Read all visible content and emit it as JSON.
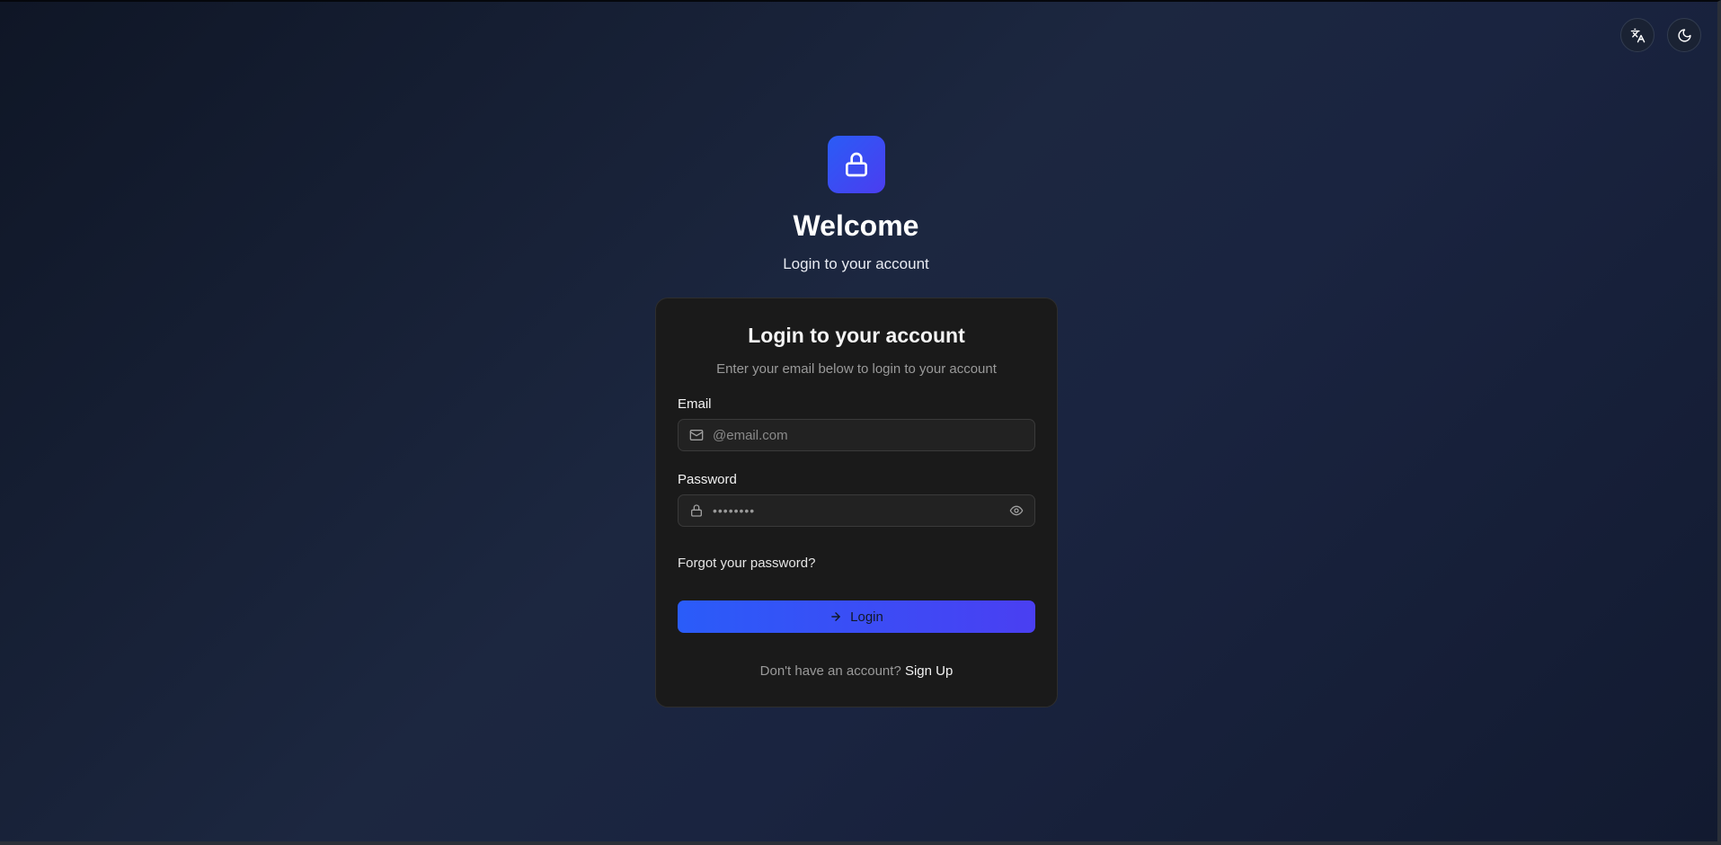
{
  "header": {
    "language_icon": "translate-icon",
    "theme_icon": "moon-icon"
  },
  "hero": {
    "logo_icon": "lock-icon",
    "title": "Welcome",
    "subtitle": "Login to your account"
  },
  "card": {
    "title": "Login to your account",
    "description": "Enter your email below to login to your account",
    "email": {
      "label": "Email",
      "placeholder": "@email.com",
      "value": "",
      "icon": "mail-icon"
    },
    "password": {
      "label": "Password",
      "masked_value": "••••••••",
      "icon": "lock-icon",
      "toggle_icon": "eye-icon"
    },
    "forgot_label": "Forgot your password?",
    "login_label": "Login",
    "login_icon": "arrow-right-icon",
    "signup_prompt": "Don't have an account?",
    "signup_label": "Sign Up"
  },
  "colors": {
    "accent_start": "#2a5cf9",
    "accent_end": "#4a3ff2",
    "card_bg": "#1a1a1a"
  }
}
